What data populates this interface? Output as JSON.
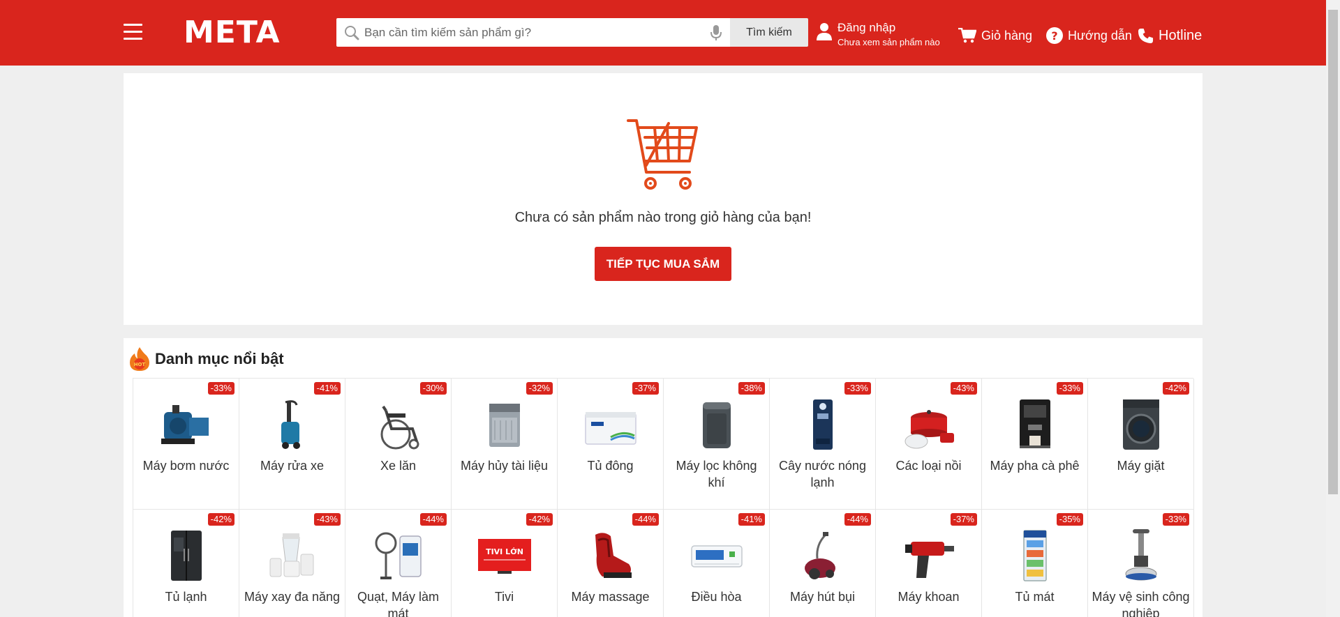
{
  "header": {
    "logo": "META",
    "search_placeholder": "Bạn cần tìm kiếm sản phẩm gì?",
    "search_button": "Tìm kiếm",
    "login_label": "Đăng nhập",
    "login_sub": "Chưa xem sản phẩm nào",
    "cart_label": "Giỏ hàng",
    "help_label": "Hướng dẫn",
    "hotline_label": "Hotline"
  },
  "empty_cart": {
    "message": "Chưa có sản phẩm nào trong giỏ hàng của bạn!",
    "button": "TIẾP TỤC MUA SẮM"
  },
  "categories": {
    "title": "Danh mục nổi bật",
    "hot_badge": "HOT",
    "items": [
      {
        "name": "Máy bơm nước",
        "discount": "-33%",
        "icon": "water-pump-icon"
      },
      {
        "name": "Máy rửa xe",
        "discount": "-41%",
        "icon": "pressure-washer-icon"
      },
      {
        "name": "Xe lăn",
        "discount": "-30%",
        "icon": "wheelchair-icon"
      },
      {
        "name": "Máy hủy tài liệu",
        "discount": "-32%",
        "icon": "paper-shredder-icon"
      },
      {
        "name": "Tủ đông",
        "discount": "-37%",
        "icon": "chest-freezer-icon"
      },
      {
        "name": "Máy lọc không khí",
        "discount": "-38%",
        "icon": "air-purifier-icon"
      },
      {
        "name": "Cây nước nóng lạnh",
        "discount": "-33%",
        "icon": "water-dispenser-icon"
      },
      {
        "name": "Các loại nồi",
        "discount": "-43%",
        "icon": "cookware-icon"
      },
      {
        "name": "Máy pha cà phê",
        "discount": "-33%",
        "icon": "coffee-machine-icon"
      },
      {
        "name": "Máy giặt",
        "discount": "-42%",
        "icon": "washing-machine-icon"
      },
      {
        "name": "Tủ lạnh",
        "discount": "-42%",
        "icon": "refrigerator-icon"
      },
      {
        "name": "Máy xay đa năng",
        "discount": "-43%",
        "icon": "blender-icon"
      },
      {
        "name": "Quạt, Máy làm mát",
        "discount": "-44%",
        "icon": "fan-cooler-icon"
      },
      {
        "name": "Tivi",
        "discount": "-42%",
        "icon": "tv-icon",
        "image_text": "TIVI LỚN"
      },
      {
        "name": "Máy massage",
        "discount": "-44%",
        "icon": "massage-chair-icon"
      },
      {
        "name": "Điều hòa",
        "discount": "-41%",
        "icon": "air-conditioner-icon"
      },
      {
        "name": "Máy hút bụi",
        "discount": "-44%",
        "icon": "vacuum-cleaner-icon"
      },
      {
        "name": "Máy khoan",
        "discount": "-37%",
        "icon": "drill-icon"
      },
      {
        "name": "Tủ mát",
        "discount": "-35%",
        "icon": "display-fridge-icon"
      },
      {
        "name": "Máy vệ sinh công nghiệp",
        "discount": "-33%",
        "icon": "floor-scrubber-icon"
      }
    ]
  },
  "colors": {
    "brand_red": "#d9251d",
    "cart_orange": "#e24a1b"
  }
}
